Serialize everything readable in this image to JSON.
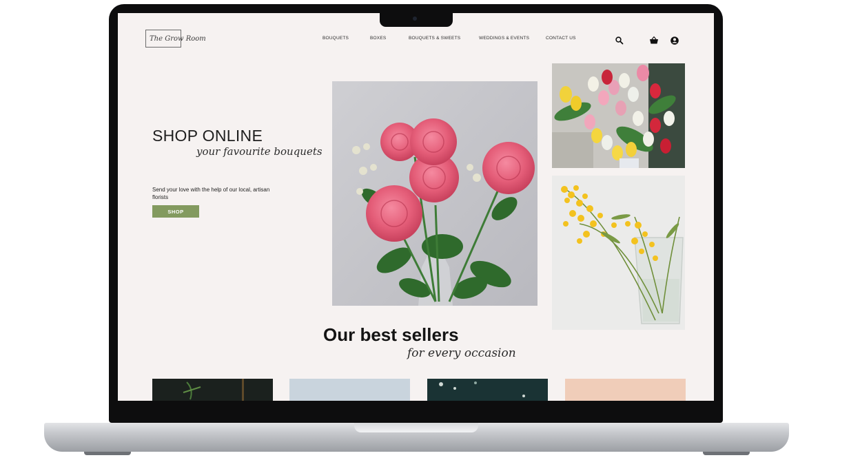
{
  "brand": {
    "logo_text": "The Grow Room"
  },
  "nav": {
    "items": [
      {
        "label": "BOUQUETS"
      },
      {
        "label": "BOXES"
      },
      {
        "label": "BOUQUETS  &  SWEETS"
      },
      {
        "label": "WEDDINGS & EVENTS"
      },
      {
        "label": "CONTACT US"
      }
    ],
    "icons": [
      "search-icon",
      "basket-icon",
      "account-icon"
    ]
  },
  "hero": {
    "title": "SHOP ONLINE",
    "subtitle": "your favourite bouquets",
    "description": "Send your love with the help of our local, artisan florists",
    "button_label": "SHOP"
  },
  "images": {
    "main": "pink-roses-bouquet",
    "top_right": "tulips-bouquet",
    "bottom_right": "mimosa-in-vase"
  },
  "best_sellers": {
    "title": "Our best sellers",
    "subtitle": "for every occasion",
    "cards": [
      "product-card-1",
      "product-card-2",
      "product-card-3",
      "product-card-4"
    ]
  },
  "colors": {
    "page_bg": "#f6f2f1",
    "accent": "#839a5f",
    "text": "#1f1f1f"
  }
}
